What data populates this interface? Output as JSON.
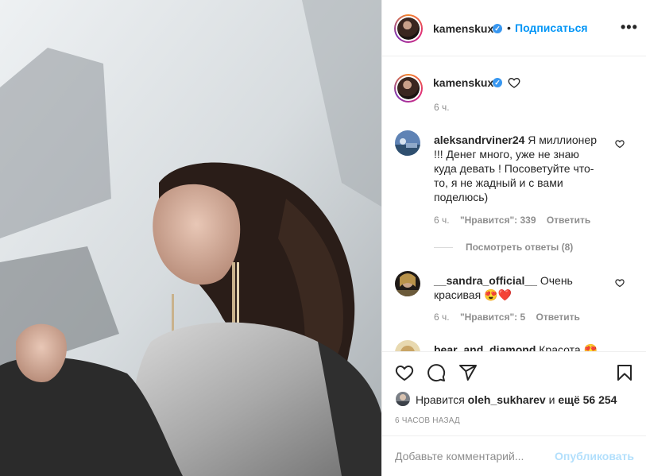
{
  "post": {
    "author": "kamenskux",
    "follow_label": "Подписаться",
    "separator": "•",
    "more_label": "•••",
    "caption_time": "6 ч."
  },
  "comments": [
    {
      "username": "aleksandrviner24",
      "text": "Я миллионер !!! Денег много, уже не знаю куда девать ! Посоветуйте что-то, я не жадный и с вами поделюсь)",
      "time": "6 ч.",
      "likes": "\"Нравится\": 339",
      "reply": "Ответить",
      "view_replies": "Посмотреть ответы (8)"
    },
    {
      "username": "__sandra_official__",
      "text": "Очень красивая 😍❤️",
      "time": "6 ч.",
      "likes": "\"Нравится\": 5",
      "reply": "Ответить"
    },
    {
      "username": "bear_and_diamond",
      "text": "Красота 😍"
    }
  ],
  "likes": {
    "prefix": "Нравится",
    "user": "oleh_sukharev",
    "conj": "и",
    "rest": "ещё 56 254"
  },
  "posted_ago": "6 ЧАСОВ НАЗАД",
  "comment_box": {
    "placeholder": "Добавьте комментарий...",
    "publish_label": "Опубликовать"
  },
  "colors": {
    "accent": "#0095f6",
    "publish_disabled": "#b2dffc",
    "verified": "#3897f0",
    "muted": "#8e8e8e",
    "heart_red": "#ed4956"
  }
}
